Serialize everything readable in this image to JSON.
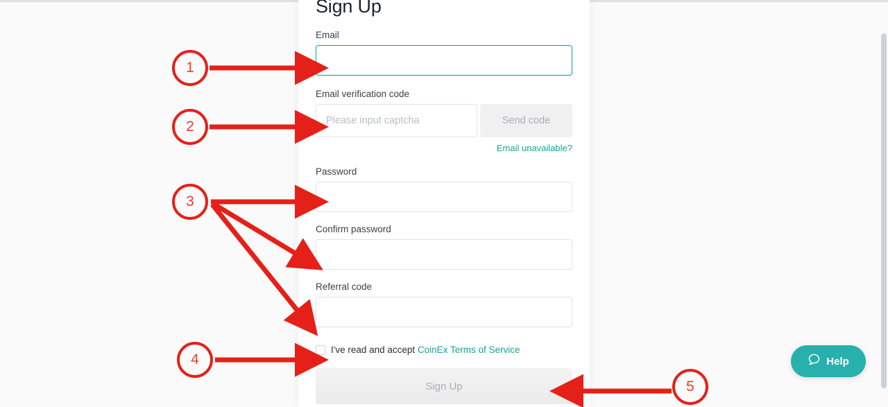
{
  "page": {
    "background_color": "#fafafa",
    "card_background": "#ffffff",
    "accent_color": "#14a398",
    "annotation_color": "#e52019"
  },
  "signup": {
    "title": "Sign Up",
    "email": {
      "label": "Email",
      "value": "",
      "placeholder": "",
      "focused": true
    },
    "verification": {
      "label": "Email verification code",
      "value": "",
      "placeholder": "Please input captcha",
      "send_code_label": "Send code",
      "send_code_disabled": true,
      "helper_link": "Email unavailable?"
    },
    "password": {
      "label": "Password",
      "value": "",
      "placeholder": ""
    },
    "confirm_password": {
      "label": "Confirm password",
      "value": "",
      "placeholder": ""
    },
    "referral": {
      "label": "Referral code",
      "value": "",
      "placeholder": ""
    },
    "terms": {
      "checked": false,
      "prefix": "I've read and accept ",
      "link_label": "CoinEx Terms of Service"
    },
    "submit": {
      "label": "Sign Up",
      "disabled": true
    }
  },
  "help_widget": {
    "label": "Help",
    "icon": "speech-bubble-icon",
    "color": "#27b0ac"
  },
  "annotations": [
    {
      "number": "1",
      "target": "email-input"
    },
    {
      "number": "2",
      "target": "verification-code-input"
    },
    {
      "number": "3",
      "target": "password-confirm-referral-inputs"
    },
    {
      "number": "4",
      "target": "terms-checkbox"
    },
    {
      "number": "5",
      "target": "sign-up-button"
    }
  ]
}
